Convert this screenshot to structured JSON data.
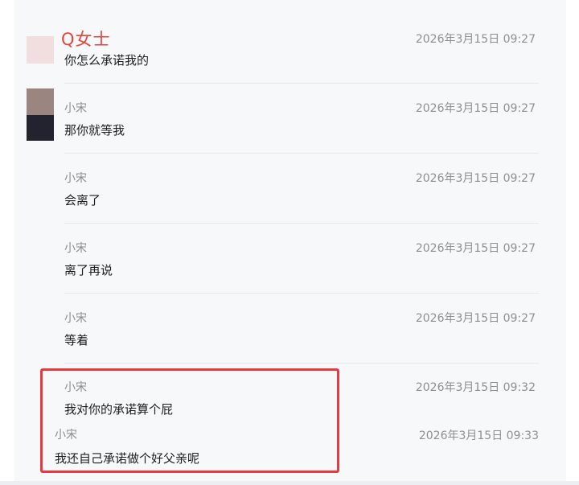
{
  "messages": [
    {
      "sender": "Q女士",
      "time": "2026年3月15日 09:27",
      "text": "你怎么承诺我的"
    },
    {
      "sender": "小宋",
      "time": "2026年3月15日 09:27",
      "text": "那你就等我"
    },
    {
      "sender": "小宋",
      "time": "2026年3月15日 09:27",
      "text": "会离了"
    },
    {
      "sender": "小宋",
      "time": "2026年3月15日 09:27",
      "text": "离了再说"
    },
    {
      "sender": "小宋",
      "time": "2026年3月15日 09:27",
      "text": "等着"
    },
    {
      "sender": "小宋",
      "time": "2026年3月15日 09:32",
      "text": "我对你的承诺算个屁"
    },
    {
      "sender": "小宋",
      "time": "2026年3月15日 09:33",
      "text": "我还自己承诺做个好父亲呢"
    }
  ],
  "colors": {
    "highlight_border": "#e8393e",
    "main_sender": "#e0463a",
    "background": "#f7f8fa"
  }
}
